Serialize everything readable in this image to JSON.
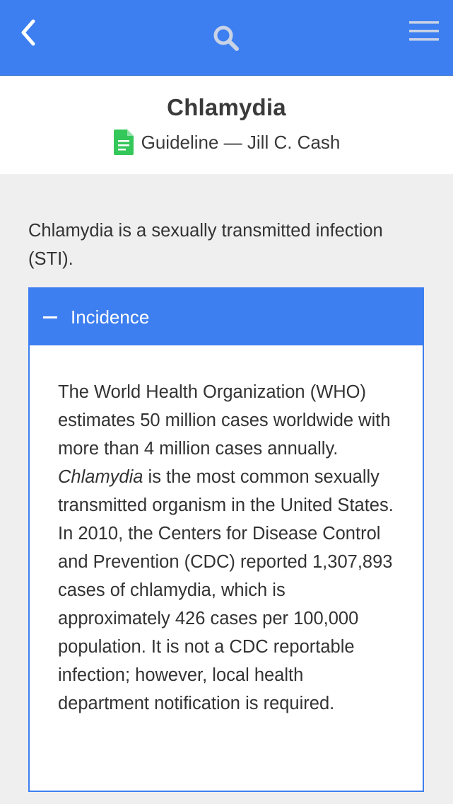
{
  "topbar": {
    "back_icon": "chevron-left-icon",
    "search_icon": "search-icon",
    "menu_icon": "hamburger-menu-icon",
    "background_color": "#3d7ff0"
  },
  "header": {
    "title": "Chlamydia",
    "doc_icon": "document-icon",
    "doc_icon_color": "#34c759",
    "subtitle": "Guideline — Jill C. Cash"
  },
  "intro": "Chlamydia is a sexually transmitted infection (STI).",
  "section": {
    "title": "Incidence",
    "expanded": true,
    "body_part1": "The World Health Organization (WHO) estimates 50 million cases worldwide with more than 4 million cases annually. ",
    "body_italic": "Chlamydia",
    "body_part2": " is the most common sexually transmitted organism in the United States. In 2010, the Centers for Disease Control and Prevention (CDC) reported 1,307,893 cases of chlamydia, which is approximately 426 cases per 100,000 population. It is not a CDC reportable infection; however, local health department notification is required."
  }
}
